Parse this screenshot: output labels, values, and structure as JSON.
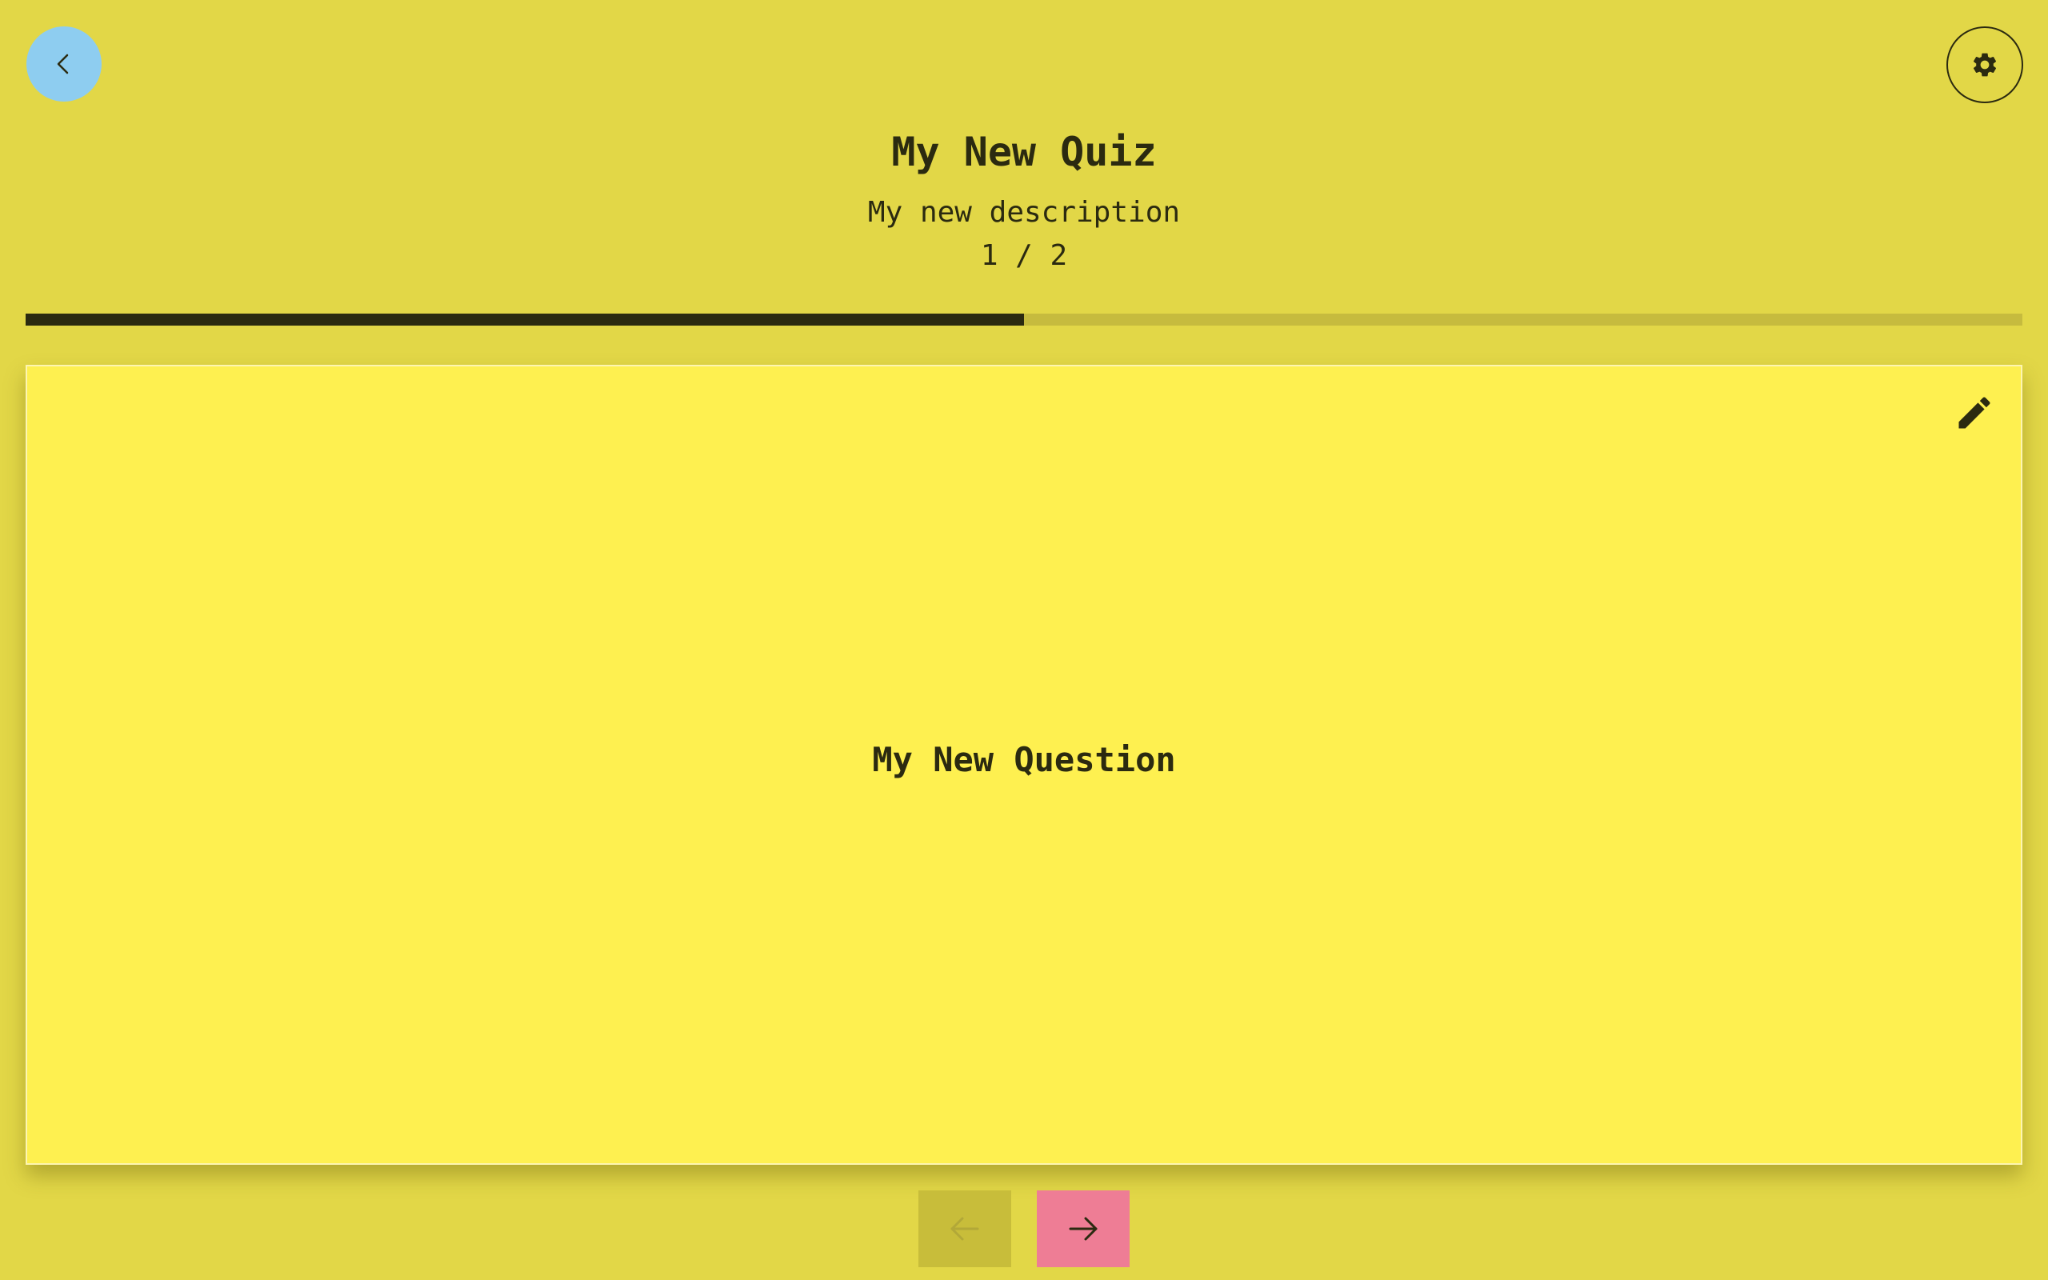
{
  "header": {
    "back_icon": "chevron-left-icon",
    "settings_icon": "gear-icon"
  },
  "quiz": {
    "title": "My New Quiz",
    "description": "My new description",
    "counter": "1 / 2",
    "progress_fraction": 0.5
  },
  "card": {
    "question": "My New Question",
    "edit_icon": "pencil-icon"
  },
  "navigation": {
    "prev_icon": "arrow-left-icon",
    "prev_disabled": true,
    "next_icon": "arrow-right-icon"
  },
  "colors": {
    "background": "#e2d747",
    "card": "#fef050",
    "back_button": "#8ecdf0",
    "next_button": "#ee7d95",
    "prev_button_disabled": "#c8bd3a",
    "progress_fill": "#2b2a10",
    "progress_track": "#c6bb3e",
    "text": "#2b2a10"
  }
}
